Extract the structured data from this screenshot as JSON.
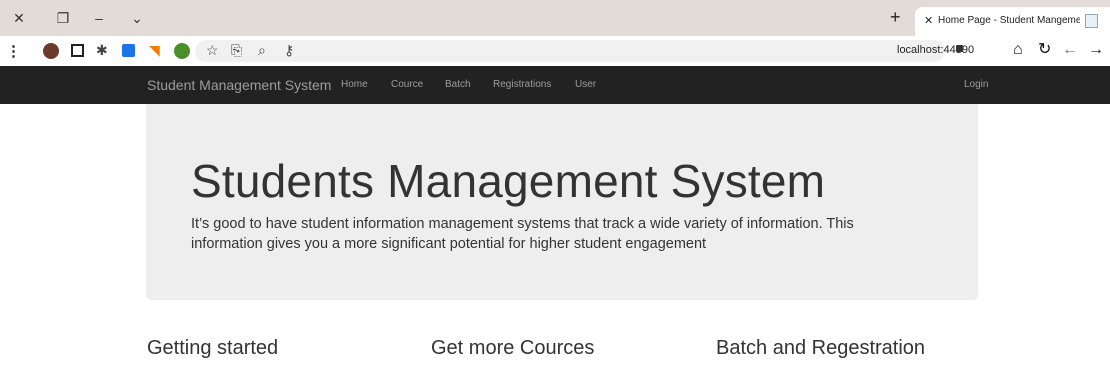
{
  "browser": {
    "tab_title": "Home Page - Student Mangement System",
    "url": "localhost:44390",
    "window_controls": [
      "close-icon",
      "restore-icon",
      "minimize-icon",
      "chevron-down-icon"
    ]
  },
  "navbar": {
    "brand": "Student Management System",
    "links": [
      "Home",
      "Cource",
      "Batch",
      "Registrations",
      "User"
    ],
    "login": "Login"
  },
  "jumbotron": {
    "title": "Students Management System",
    "lead": "It’s good to have student information management systems that track a wide variety of information. This information gives you a more significant potential for higher student engagement"
  },
  "columns": [
    {
      "title": "Getting started"
    },
    {
      "title": "Get more Cources"
    },
    {
      "title": "Batch and Regestration"
    }
  ],
  "colors": {
    "navbar_bg": "#222222",
    "navbar_text": "#9d9d9d",
    "jumbotron_bg": "#eeeeee",
    "tabstrip_bg": "#e3dbd7"
  }
}
